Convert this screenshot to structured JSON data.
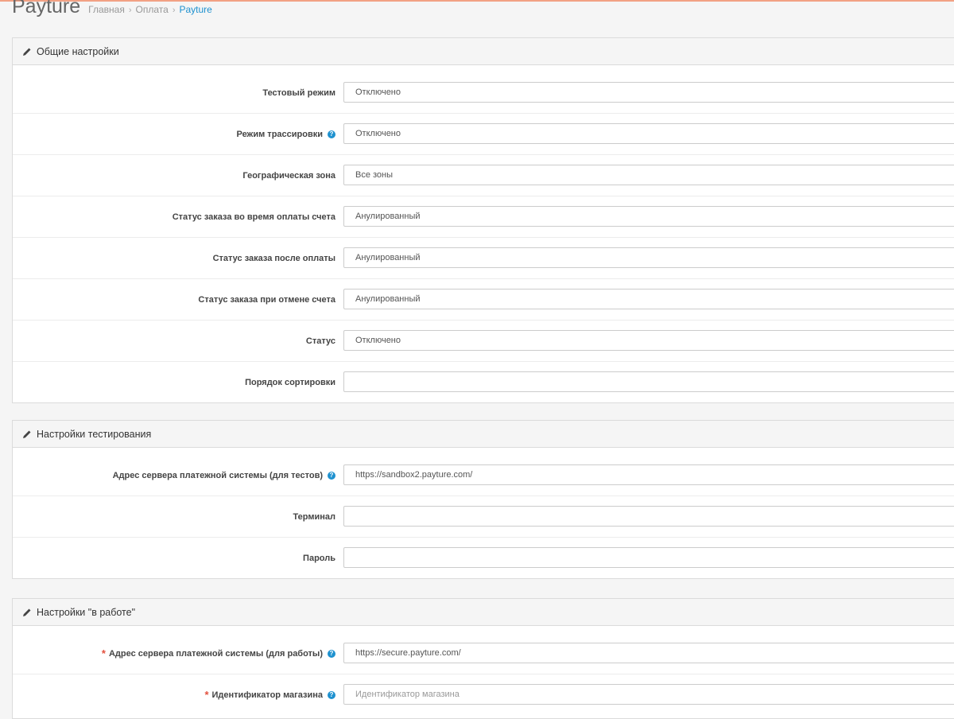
{
  "page": {
    "title": "Payture",
    "breadcrumb": [
      "Главная",
      "Оплата",
      "Payture"
    ]
  },
  "colors": {
    "accent": "#1e91cf",
    "required": "#e3503e",
    "top_line": "#f2a184"
  },
  "panels": [
    {
      "title": "Общие настройки",
      "icon": "pencil-icon",
      "fields": [
        {
          "label": "Тестовый режим",
          "value": "Отключено"
        },
        {
          "label": "Режим трассировки",
          "value": "Отключено",
          "help": true
        },
        {
          "label": "Географическая зона",
          "value": "Все зоны"
        },
        {
          "label": "Статус заказа во время оплаты счета",
          "value": "Анулированный"
        },
        {
          "label": "Статус заказа после оплаты",
          "value": "Анулированный"
        },
        {
          "label": "Статус заказа при отмене счета",
          "value": "Анулированный"
        },
        {
          "label": "Статус",
          "value": "Отключено"
        },
        {
          "label": "Порядок сортировки",
          "value": ""
        }
      ]
    },
    {
      "title": "Настройки тестирования",
      "icon": "pencil-icon",
      "fields": [
        {
          "label": "Адрес сервера платежной системы (для тестов)",
          "value": "https://sandbox2.payture.com/",
          "help": true
        },
        {
          "label": "Терминал",
          "value": ""
        },
        {
          "label": "Пароль",
          "value": ""
        }
      ]
    },
    {
      "title": "Настройки \"в работе\"",
      "icon": "pencil-icon",
      "fields": [
        {
          "label": "Адрес сервера платежной системы (для работы)",
          "value": "https://secure.payture.com/",
          "help": true,
          "required": true
        },
        {
          "label": "Идентификатор магазина",
          "value": "",
          "placeholder": "Идентификатор магазина",
          "help": true,
          "required": true
        }
      ]
    }
  ]
}
